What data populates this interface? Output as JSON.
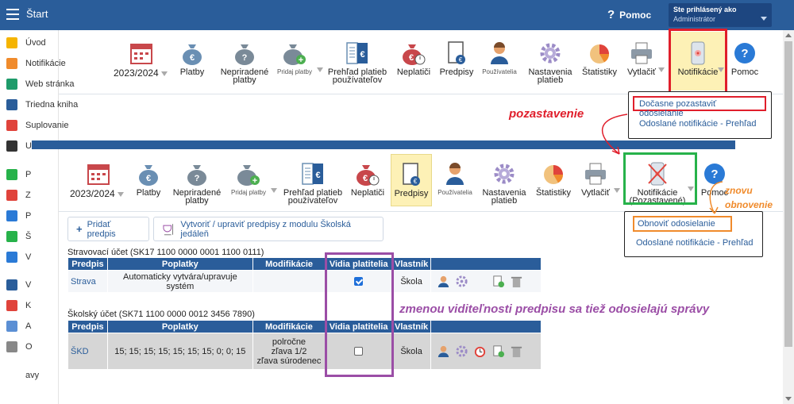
{
  "topbar": {
    "title": "Štart",
    "help": "Pomoc",
    "user_line1": "Ste prihlásený ako",
    "user_line2": "Administrátor"
  },
  "sidebar": {
    "items": [
      {
        "label": "Úvod",
        "icon": "star-icon",
        "color": "#f5b400"
      },
      {
        "label": "Notifikácie",
        "icon": "envelope-icon",
        "color": "#f08b2c"
      },
      {
        "label": "Web stránka",
        "icon": "house-icon",
        "color": "#1e9b6a"
      },
      {
        "label": "Triedna kniha",
        "icon": "book-icon",
        "color": "#2a5d9a"
      },
      {
        "label": "Suplovanie",
        "icon": "person-icon",
        "color": "#e0433b"
      },
      {
        "label": "U",
        "icon": "calendar-icon",
        "color": "#333333"
      },
      {
        "label": "P",
        "icon": "check-circle-icon",
        "color": "#27b24a"
      },
      {
        "label": "Z",
        "icon": "alarm-icon",
        "color": "#e0433b"
      },
      {
        "label": "P",
        "icon": "briefcase-icon",
        "color": "#2a7ad6"
      },
      {
        "label": "Š",
        "icon": "shield-icon",
        "color": "#27b24a"
      },
      {
        "label": "V",
        "icon": "bar-chart-icon",
        "color": "#2a7ad6"
      },
      {
        "label": "V",
        "icon": "open-book-icon",
        "color": "#2a5d9a"
      },
      {
        "label": "K",
        "icon": "chat-icon",
        "color": "#e0433b"
      },
      {
        "label": "A",
        "icon": "pencil-icon",
        "color": "#5b8fd4"
      },
      {
        "label": "O",
        "icon": "gear-icon",
        "color": "#888888"
      },
      {
        "label": "avy",
        "icon": "",
        "color": "#ffffff"
      }
    ]
  },
  "toolbar": {
    "year": "2023/2024",
    "platby": "Platby",
    "nepriradene": "Nepriradené platby",
    "pridaj": "Pridaj platby",
    "prehlad": "Prehľad platieb používateľov",
    "neplatici": "Neplatiči",
    "predpisy": "Predpisy",
    "pouzivatelia": "Používatelia",
    "nastavenia": "Nastavenia platieb",
    "statistiky": "Štatistiky",
    "vytlacit": "Vytlačiť",
    "notifikacie": "Notifikácie",
    "notifikacie_paused": "Notifikácie (Pozastavené)",
    "pomoc": "Pomoc"
  },
  "dropdown1": {
    "item1": "Dočasne pozastaviť odosielanie",
    "item2": "Odoslané notifikácie - Prehľad"
  },
  "dropdown2": {
    "item1": "Obnoviť odosielanie",
    "item2": "Odoslané notifikácie - Prehľad"
  },
  "annotations": {
    "pause": "pozastavenie",
    "resume1": "znovu",
    "resume2": "obnovenie",
    "visibility": "zmenou viditeľnosti predpisu sa tiež odosielajú správy"
  },
  "buttons": {
    "add": "Pridať predpis",
    "create": "Vytvoriť / upraviť predpisy z modulu Školská jedáleň"
  },
  "table_headers": [
    "Predpis",
    "Poplatky",
    "Modifikácie",
    "Vidia platitelia",
    "Vlastník"
  ],
  "account1": {
    "title": "Stravovací účet (SK17 1100 0000 0001 1100 0111)",
    "row": {
      "predpis": "Strava",
      "poplatky": "Automaticky vytvára/upravuje systém",
      "modifikacie": "",
      "vidia": true,
      "vlastnik": "Škola"
    }
  },
  "account2": {
    "title": "Školský účet (SK71 1100 0000 0012 3456 7890)",
    "row": {
      "predpis": "ŠKD",
      "poplatky": "15; 15; 15; 15; 15; 15; 15; 0; 0; 15",
      "mod1": "polročne",
      "mod2": "zľava 1/2",
      "mod3": "zľava súrodenec",
      "vidia": false,
      "vlastnik": "Škola"
    }
  },
  "colors": {
    "brand": "#2a5d9a",
    "red_box": "#e01e2b",
    "green_box": "#27b24a",
    "orange": "#f08b2c",
    "purple": "#9b4ea6"
  }
}
